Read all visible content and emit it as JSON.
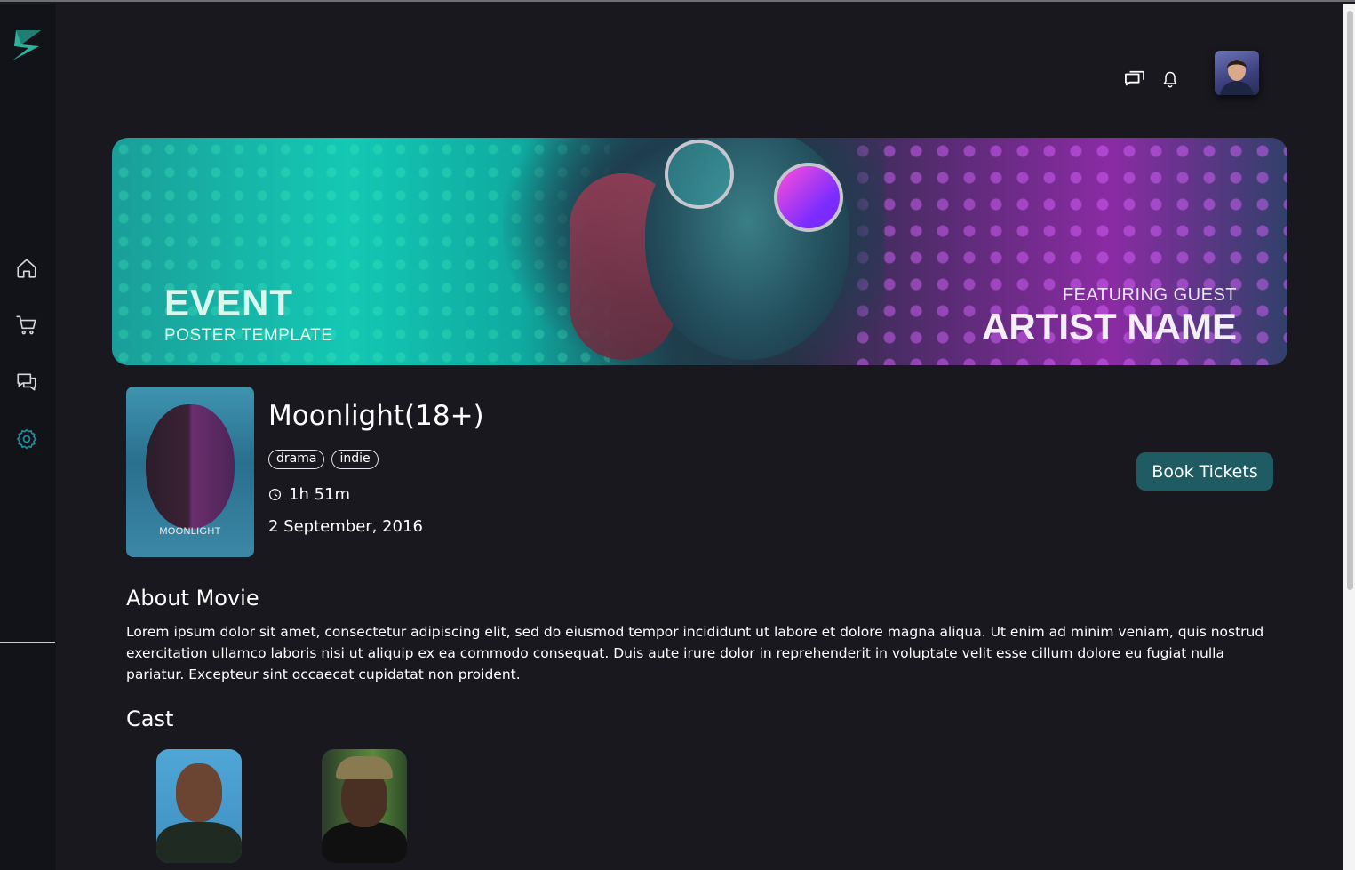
{
  "sidebar": {
    "logo": "zap-logo",
    "items": [
      {
        "icon": "home-icon"
      },
      {
        "icon": "cart-icon"
      },
      {
        "icon": "chat-icon"
      },
      {
        "icon": "settings-icon",
        "active": true
      }
    ]
  },
  "header": {
    "icons": [
      "messages-icon",
      "bell-icon"
    ],
    "avatar": "user-avatar"
  },
  "banner": {
    "event": "EVENT",
    "subtitle": "POSTER TEMPLATE",
    "featuring": "FEATURING GUEST",
    "artist": "ARTIST NAME"
  },
  "movie": {
    "poster_title": "MOONLIGHT",
    "title": "Moonlight(18+)",
    "tags": [
      "drama",
      "indie"
    ],
    "duration": "1h 51m",
    "release_date": "2 September, 2016",
    "book_label": "Book Tickets"
  },
  "about": {
    "heading": "About Movie",
    "text": "Lorem ipsum dolor sit amet, consectetur adipiscing elit, sed do eiusmod tempor incididunt ut labore et dolore magna aliqua. Ut enim ad minim veniam, quis nostrud exercitation ullamco laboris nisi ut aliquip ex ea commodo consequat. Duis aute irure dolor in reprehenderit in voluptate velit esse cillum dolore eu fugiat nulla pariatur. Excepteur sint occaecat cupidatat non proident."
  },
  "cast": {
    "heading": "Cast"
  },
  "colors": {
    "background": "#18181e",
    "sidebar": "#121219",
    "accent": "#1f5b62",
    "active_icon": "#1f8d9a"
  }
}
